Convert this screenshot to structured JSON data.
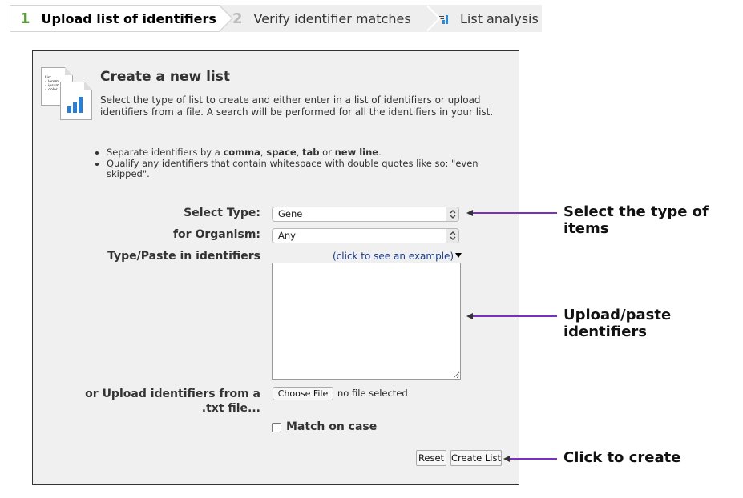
{
  "steps": [
    {
      "number": "1",
      "label": "Upload list of identifiers"
    },
    {
      "number": "2",
      "label": "Verify identifier matches"
    },
    {
      "icon": "list-analysis-icon",
      "label": "List analysis"
    }
  ],
  "panel": {
    "icon": "document-chart-icon",
    "icon_text": [
      "List",
      "• lorem",
      "• ipsum",
      "• dolor"
    ],
    "title": "Create a new list",
    "description": "Select the type of list to create and either enter in a list of identifiers or upload identifiers from a file. A search will be performed for all the identifiers in your list.",
    "hints": [
      {
        "pre": "Separate identifiers by a ",
        "b1": "comma",
        "m1": ", ",
        "b2": "space",
        "m2": ", ",
        "b3": "tab",
        "m3": " or ",
        "b4": "new line",
        "post": "."
      },
      {
        "text": "Qualify any identifiers that contain whitespace with double quotes like so: \"even skipped\"."
      }
    ]
  },
  "form": {
    "select_type_label": "Select Type:",
    "select_type_value": "Gene",
    "organism_label": "for Organism:",
    "organism_value": "Any",
    "paste_label": "Type/Paste in identifiers",
    "example_link": "(click to see an example)",
    "paste_value": "",
    "upload_label": "or Upload identifiers from a .txt file...",
    "choose_file": "Choose File",
    "file_status": "no file selected",
    "match_case_label": "Match on case",
    "match_case_checked": false,
    "reset_label": "Reset",
    "create_label": "Create List"
  },
  "callouts": {
    "type": "Select the type of items",
    "paste": "Upload/paste identifiers",
    "create": "Click to create"
  },
  "colors": {
    "step_active_number": "#5a9a3c",
    "callout_line": "#7b2fbf",
    "link": "#1b3c8a",
    "chart_icon": "#2a7fd4"
  }
}
